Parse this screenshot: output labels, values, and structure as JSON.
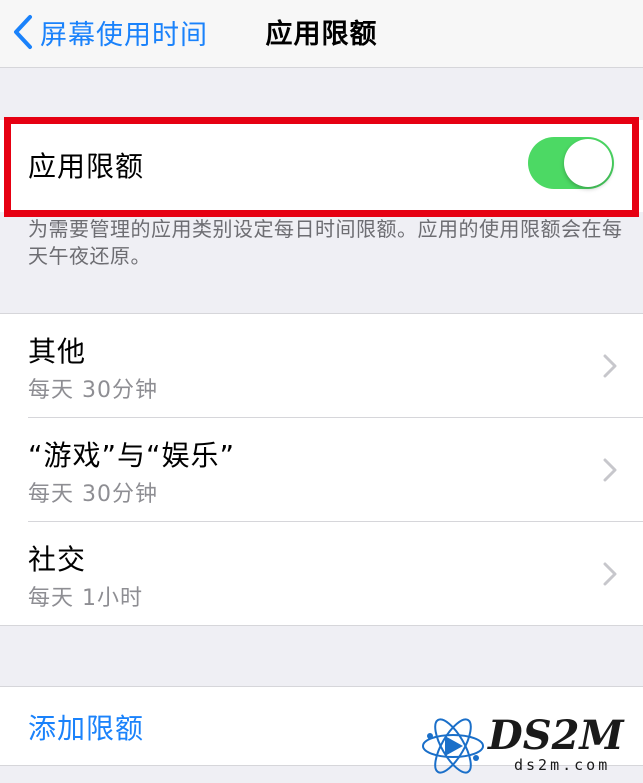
{
  "nav": {
    "back_label": "屏幕使用时间",
    "title": "应用限额"
  },
  "toggle": {
    "label": "应用限额",
    "state": "on",
    "on_color": "#4cd964"
  },
  "footer_note": "为需要管理的应用类别设定每日时间限额。应用的使用限额会在每天午夜还原。",
  "limits": [
    {
      "title": "其他",
      "subtitle": "每天 30分钟"
    },
    {
      "title": "“游戏”与“娱乐”",
      "subtitle": "每天 30分钟"
    },
    {
      "title": "社交",
      "subtitle": "每天 1小时"
    }
  ],
  "add_limit_label": "添加限额",
  "watermark": {
    "text": "DS2M",
    "sub": "ds2m.com"
  },
  "colors": {
    "accent": "#1a82fb",
    "highlight": "#e60012",
    "background": "#efeff4"
  }
}
